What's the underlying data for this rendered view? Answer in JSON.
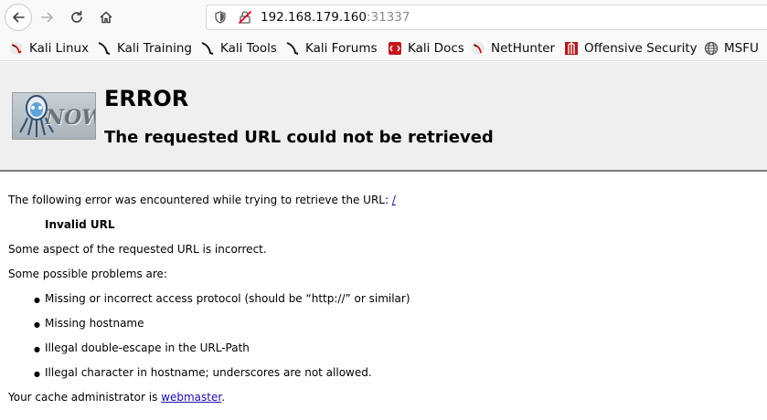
{
  "browser": {
    "url_host": "192.168.179.160",
    "url_port": ":31337"
  },
  "bookmarks": [
    {
      "label": "Kali Linux",
      "icon": "kali-dragon-icon"
    },
    {
      "label": "Kali Training",
      "icon": "kali-dragon-icon"
    },
    {
      "label": "Kali Tools",
      "icon": "kali-dragon-icon"
    },
    {
      "label": "Kali Forums",
      "icon": "kali-dragon-icon"
    },
    {
      "label": "Kali Docs",
      "icon": "kali-docs-icon"
    },
    {
      "label": "NetHunter",
      "icon": "nethunter-icon"
    },
    {
      "label": "Offensive Security",
      "icon": "offsec-icon"
    },
    {
      "label": "MSFU",
      "icon": "globe-icon"
    }
  ],
  "error_page": {
    "logo_text": "NOW",
    "title": "ERROR",
    "subtitle": "The requested URL could not be retrieved",
    "intro": "The following error was encountered while trying to retrieve the URL:",
    "url_link": "/",
    "error_name": "Invalid URL",
    "description": "Some aspect of the requested URL is incorrect.",
    "problems_heading": "Some possible problems are:",
    "problems": [
      "Missing or incorrect access protocol (should be “http://” or similar)",
      "Missing hostname",
      "Illegal double-escape in the URL-Path",
      "Illegal character in hostname; underscores are not allowed."
    ],
    "admin_prefix": "Your cache administrator is",
    "admin_link": "webmaster",
    "admin_suffix": "."
  },
  "colors": {
    "header_bg": "#efefef",
    "link": "#1a0dab",
    "toolbar_bg": "#f9f9fa"
  }
}
